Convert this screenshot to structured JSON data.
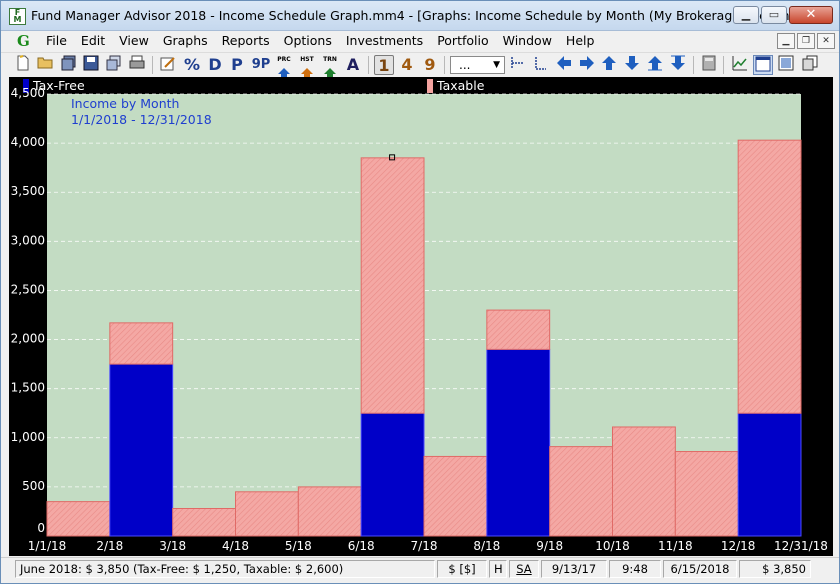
{
  "window": {
    "title": "Fund Manager Advisor 2018 - Income Schedule Graph.mm4 - [Graphs: Income Schedule by Month (My Brokerage Account)]",
    "icon_label": [
      "F",
      "M"
    ],
    "buttons": {
      "minimize": "minimize-icon",
      "maximize": "maximize-icon",
      "close": "close-icon"
    }
  },
  "menu": {
    "logo": "G",
    "items": [
      "File",
      "Edit",
      "View",
      "Graphs",
      "Reports",
      "Options",
      "Investments",
      "Portfolio",
      "Window",
      "Help"
    ]
  },
  "toolbar": {
    "letters": {
      "d": "D",
      "p": "P",
      "nine_p": "9P",
      "a": "A",
      "percent": "%"
    },
    "small_labels": {
      "prc": "PRC",
      "hst": "HST",
      "trn": "TRN"
    },
    "period_buttons": [
      "1",
      "4",
      "9"
    ],
    "active_period": "1",
    "dropdown_value": "...",
    "icons": [
      "new-icon",
      "open-icon",
      "save-all-icon",
      "save-icon",
      "copy-icon",
      "print-icon",
      "edit-icon",
      "percent-icon",
      "left-arrow-icon",
      "right-arrow-icon",
      "up-arrow-icon",
      "down-arrow-icon",
      "calculator-icon",
      "chart-icon",
      "window-icon",
      "copy-window-icon"
    ]
  },
  "legend": [
    {
      "label": "Tax-Free",
      "color": "#0000c8"
    },
    {
      "label": "Taxable",
      "color": "#f4a3a0"
    }
  ],
  "chart_data": {
    "type": "bar",
    "stacked": true,
    "title": "Income by Month",
    "subtitle": "1/1/2018 - 12/31/2018",
    "x_ticks": [
      "1/1/18",
      "2/18",
      "3/18",
      "4/18",
      "5/18",
      "6/18",
      "7/18",
      "8/18",
      "9/18",
      "10/18",
      "11/18",
      "12/18",
      "12/31/18"
    ],
    "categories": [
      "Jan",
      "Feb",
      "Mar",
      "Apr",
      "May",
      "Jun",
      "Jul",
      "Aug",
      "Sep",
      "Oct",
      "Nov",
      "Dec"
    ],
    "series": [
      {
        "name": "Tax-Free",
        "color": "#0000c8",
        "values": [
          0,
          1750,
          0,
          0,
          0,
          1250,
          0,
          1900,
          0,
          0,
          0,
          1250
        ]
      },
      {
        "name": "Taxable",
        "color": "#f4a3a0",
        "values": [
          350,
          420,
          280,
          450,
          500,
          2600,
          810,
          400,
          910,
          1110,
          860,
          2780
        ]
      }
    ],
    "ylim": [
      0,
      4500
    ],
    "y_ticks": [
      "0",
      "500",
      "1,000",
      "1,500",
      "2,000",
      "2,500",
      "3,000",
      "3,500",
      "4,000",
      "4,500"
    ],
    "plot_background": "#c3dcc3",
    "grid": true,
    "legend_position": "top"
  },
  "status": {
    "summary": "June 2018: $ 3,850 (Tax-Free: $ 1,250, Taxable: $ 2,600)",
    "currency": "$ [$]",
    "h": "H",
    "sa": "SA",
    "date": "9/13/17",
    "time": "9:48",
    "price_date": "6/15/2018",
    "value": "$ 3,850"
  }
}
